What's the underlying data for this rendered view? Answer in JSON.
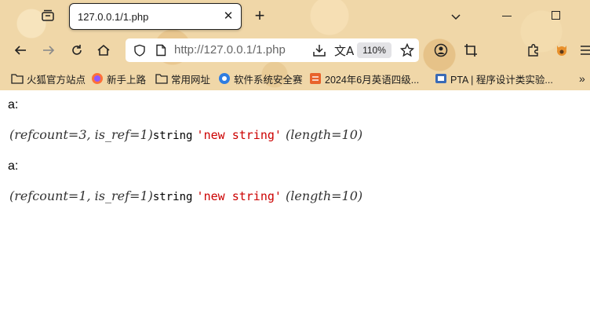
{
  "browser": {
    "tab": {
      "title": "127.0.0.1/1.php"
    },
    "url": "http://127.0.0.1/1.php",
    "zoom": "110%",
    "bookmarks": [
      {
        "label": "火狐官方站点",
        "icon": "folder-icon"
      },
      {
        "label": "新手上路",
        "icon": "firefox-icon"
      },
      {
        "label": "常用网址",
        "icon": "folder-icon"
      },
      {
        "label": "软件系统安全赛",
        "icon": "site-icon"
      },
      {
        "label": "2024年6月英语四级...",
        "icon": "doc-icon"
      },
      {
        "label": "PTA | 程序设计类实验...",
        "icon": "pta-icon"
      }
    ],
    "colors": {
      "frame": "#f0d7a8",
      "string_value": "#cc0000"
    }
  },
  "page": {
    "dumps": [
      {
        "label": "a:",
        "meta": "(refcount=3, is_ref=1)",
        "type": "string",
        "value": "'new string'",
        "length": "(length=10)"
      },
      {
        "label": "a:",
        "meta": "(refcount=1, is_ref=1)",
        "type": "string",
        "value": "'new string'",
        "length": "(length=10)"
      }
    ]
  }
}
